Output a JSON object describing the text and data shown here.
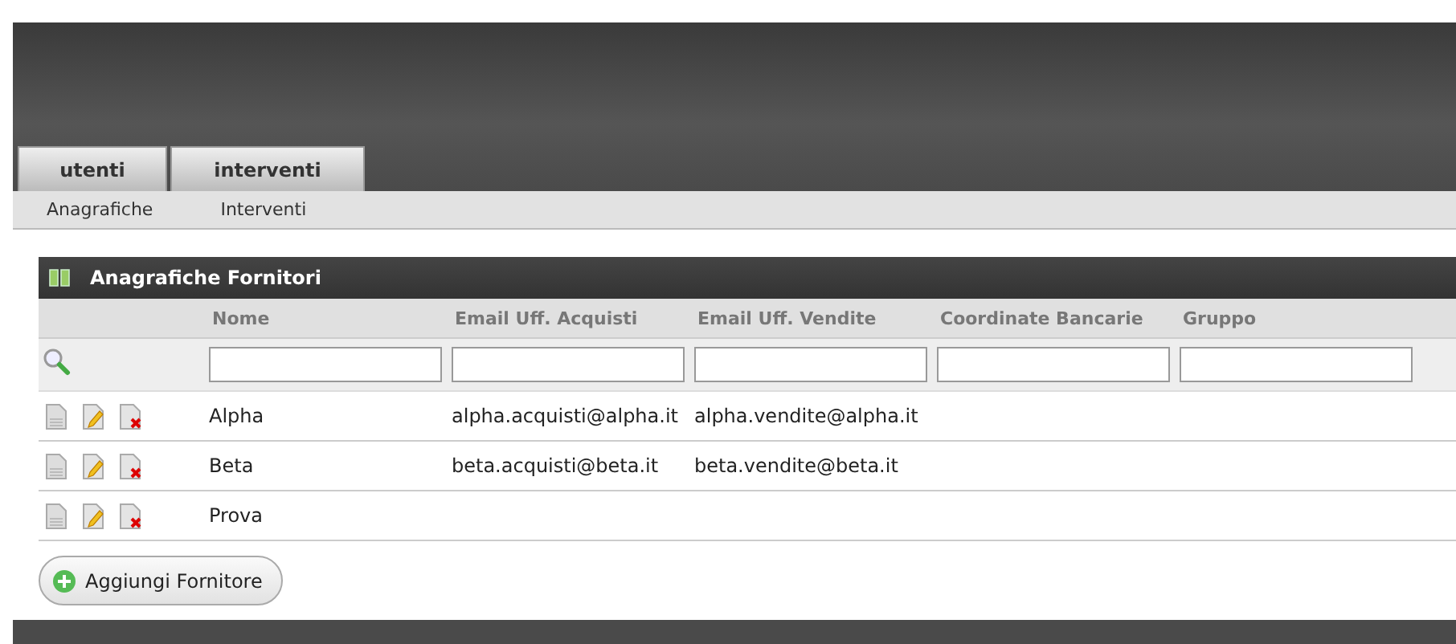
{
  "tabs": [
    {
      "label": "utenti"
    },
    {
      "label": "interventi"
    }
  ],
  "subnav": [
    "Anagrafiche",
    "Interventi"
  ],
  "panel": {
    "title": "Anagrafiche Fornitori",
    "columns": [
      "Nome",
      "Email Uff. Acquisti",
      "Email Uff. Vendite",
      "Coordinate Bancarie",
      "Gruppo"
    ],
    "rows": [
      {
        "cells": [
          "Alpha",
          "alpha.acquisti@alpha.it",
          "alpha.vendite@alpha.it",
          "",
          ""
        ]
      },
      {
        "cells": [
          "Beta",
          "beta.acquisti@beta.it",
          "beta.vendite@beta.it",
          "",
          ""
        ]
      },
      {
        "cells": [
          "Prova",
          "",
          "",
          "",
          ""
        ]
      }
    ],
    "add_button": "Aggiungi Fornitore"
  }
}
